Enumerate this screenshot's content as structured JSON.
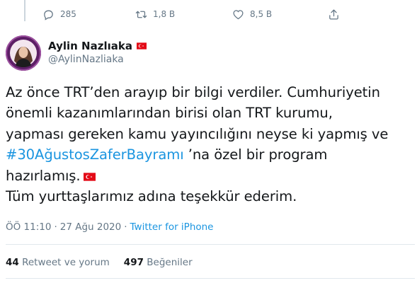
{
  "previous_tweet_actions": {
    "reply_count": "285",
    "retweet_count": "1,8 B",
    "like_count": "8,5 B"
  },
  "author": {
    "name": "Aylin Nazlıaka",
    "handle": "@AylinNazliaka"
  },
  "tweet": {
    "line1": "Az önce TRT’den arayıp bir bilgi verdiler. Cumhuriyetin",
    "line2": "önemli kazanımlarından birisi olan TRT kurumu,",
    "line3": "yapması gereken kamu yayıncılığını neyse ki yapmış ve",
    "hashtag": "#30AğustosZaferBayramı",
    "line4_rest": " ’na özel bir program",
    "line5": "hazırlamış.",
    "line6": "Tüm yurttaşlarımız adına teşekkür ederim."
  },
  "meta": {
    "time": "ÖÖ 11:10",
    "separator1": "·",
    "date": "27 Ağu 2020",
    "separator2": "·",
    "source": "Twitter for iPhone"
  },
  "stats": {
    "retweet_count": "44",
    "retweet_label": "Retweet ve yorum",
    "like_count": "497",
    "like_label": "Beğeniler"
  },
  "colors": {
    "text": "#14171a",
    "secondary": "#657786",
    "link": "#1b95e0",
    "flag_red": "#e30a17"
  }
}
